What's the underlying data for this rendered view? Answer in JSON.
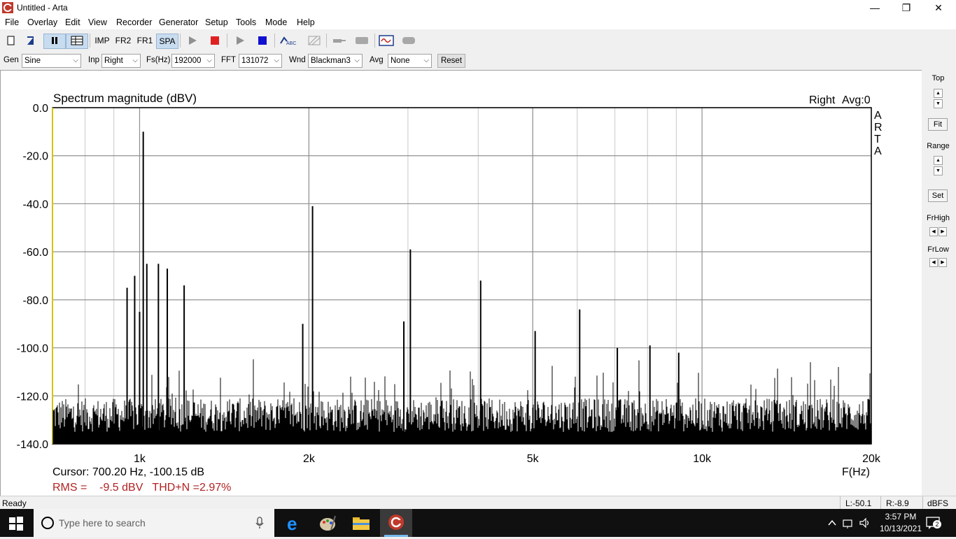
{
  "window": {
    "title": "Untitled - Arta",
    "minimize": "—",
    "maximize": "❐",
    "close": "✕"
  },
  "menu": [
    "File",
    "Overlay",
    "Edit",
    "View",
    "Recorder",
    "Generator",
    "Setup",
    "Tools",
    "Mode",
    "Help"
  ],
  "toolbar": {
    "imp": "IMP",
    "fr2": "FR2",
    "fr1": "FR1",
    "spa": "SPA"
  },
  "controls": {
    "gen_label": "Gen",
    "gen_value": "Sine",
    "inp_label": "Inp",
    "inp_value": "Right",
    "fs_label": "Fs(Hz)",
    "fs_value": "192000",
    "fft_label": "FFT",
    "fft_value": "131072",
    "wnd_label": "Wnd",
    "wnd_value": "Blackman3",
    "avg_label": "Avg",
    "avg_value": "None",
    "reset": "Reset"
  },
  "plot": {
    "title": "Spectrum magnitude (dBV)",
    "channel": "Right",
    "avg": "Avg:0",
    "watermark": [
      "A",
      "R",
      "T",
      "A"
    ],
    "cursor": "Cursor: 700.20 Hz, -100.15 dB",
    "rms": "RMS =    -9.5 dBV   THD+N =2.97%",
    "xlabel": "F(Hz)"
  },
  "right_panel": {
    "top": "Top",
    "fit": "Fit",
    "range": "Range",
    "set": "Set",
    "frhigh": "FrHigh",
    "frlow": "FrLow"
  },
  "status": {
    "ready": "Ready",
    "left": "L:-50.1",
    "right": "R:-8.9",
    "unit": "dBFS"
  },
  "taskbar": {
    "search_placeholder": "Type here to search",
    "time": "3:57 PM",
    "date": "10/13/2021",
    "notifications": "2"
  },
  "colors": {
    "accent": "#0078d7",
    "rms_text": "#b22222",
    "trace": "#000000",
    "grid": "#a0a0a0",
    "left_axis": "#d4c400"
  },
  "chart_data": {
    "type": "line",
    "title": "Spectrum magnitude (dBV)",
    "xlabel": "F(Hz)",
    "ylabel": "",
    "xscale": "log",
    "xlim": [
      700,
      20000
    ],
    "ylim": [
      -140,
      0
    ],
    "yticks": [
      0,
      -20,
      -40,
      -60,
      -80,
      -100,
      -120,
      -140
    ],
    "ytick_labels": [
      "0.0",
      "-20.0",
      "-40.0",
      "-60.0",
      "-80.0",
      "-100.0",
      "-120.0",
      "-140.0"
    ],
    "xtick_values": [
      1000,
      2000,
      5000,
      10000,
      20000
    ],
    "xtick_labels": [
      "1k",
      "2k",
      "5k",
      "10k",
      "20k"
    ],
    "grid": true,
    "noise_floor_db": -128,
    "series": [
      {
        "peaks": [
          {
            "x": 1000,
            "y": -85
          },
          {
            "x": 1015,
            "y": -10
          },
          {
            "x": 1030,
            "y": -65
          },
          {
            "x": 980,
            "y": -70
          },
          {
            "x": 950,
            "y": -75
          },
          {
            "x": 1080,
            "y": -65
          },
          {
            "x": 1120,
            "y": -67
          },
          {
            "x": 1200,
            "y": -74
          },
          {
            "x": 2030,
            "y": -41
          },
          {
            "x": 1950,
            "y": -90
          },
          {
            "x": 3030,
            "y": -59
          },
          {
            "x": 2950,
            "y": -89
          },
          {
            "x": 4040,
            "y": -72
          },
          {
            "x": 5050,
            "y": -93
          },
          {
            "x": 6060,
            "y": -84
          },
          {
            "x": 7070,
            "y": -100
          },
          {
            "x": 8080,
            "y": -99
          },
          {
            "x": 9090,
            "y": -102
          }
        ]
      }
    ]
  }
}
